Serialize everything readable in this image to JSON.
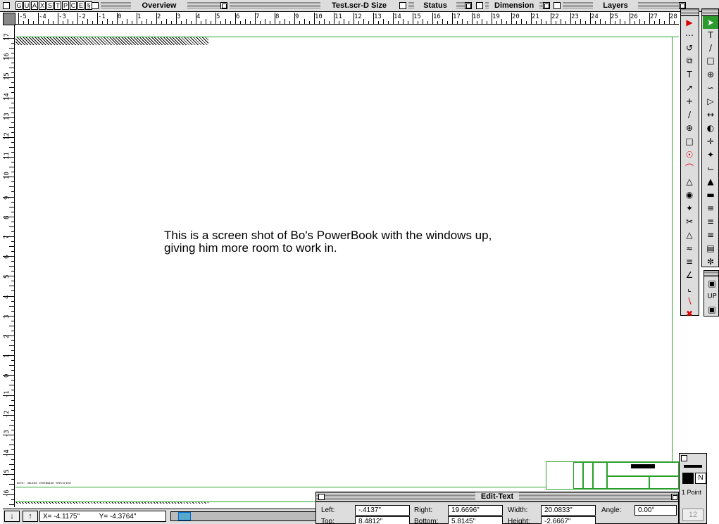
{
  "window": {
    "title": "Test.scr-D Size",
    "tool_letters": [
      "G",
      "U",
      "A",
      "X",
      "S",
      "T",
      "P",
      "C",
      "E",
      "§"
    ]
  },
  "palettes": {
    "overview": "Overview",
    "status": "Status",
    "dimension": "Dimension",
    "layers": "Layers",
    "edit_text": "Edit-Text"
  },
  "rulers": {
    "top_labels": [
      "-5",
      "-4",
      "-3",
      "-2",
      "-1",
      "0",
      "1",
      "2",
      "3",
      "4",
      "5",
      "6",
      "7",
      "8",
      "9",
      "10",
      "11",
      "12",
      "13",
      "14",
      "15",
      "16",
      "17",
      "18",
      "19",
      "20",
      "21",
      "22",
      "23",
      "24",
      "25",
      "26",
      "27",
      "28"
    ],
    "left_labels": [
      "17",
      "16",
      "15",
      "14",
      "13",
      "12",
      "11",
      "10",
      "9",
      "8",
      "7",
      "6",
      "5",
      "4",
      "3",
      "2",
      "1",
      "0",
      "-1",
      "-2",
      "-3",
      "-4",
      "-5",
      "-6"
    ]
  },
  "canvas": {
    "note_line1": "This is a screen shot of Bo's PowerBook with the windows up,",
    "note_line2": "giving him more room to work in.",
    "footnote": "NOTE: UNLESS OTHERWISE SPECIFIED"
  },
  "status": {
    "x_label": "X=",
    "x_value": "-4.1175\"",
    "y_label": "Y=",
    "y_value": "-4.3764\""
  },
  "edit_text": {
    "left_label": "Left:",
    "left_value": "-.4137\"",
    "right_label": "Right:",
    "right_value": "19.6696\"",
    "width_label": "Width:",
    "width_value": "20.0833\"",
    "angle_label": "Angle:",
    "angle_value": "0.00°",
    "top_label": "Top:",
    "top_value": "8.4812\"",
    "bottom_label": "Bottom:",
    "bottom_value": "5.8145\"",
    "height_label": "Height:",
    "height_value": "-2.6667\""
  },
  "tool_palette": {
    "letter_tool": "T",
    "up_label": "UP"
  },
  "pen": {
    "pattern_letter": "N",
    "weight_label": "1 Point",
    "size_value": "12"
  },
  "colors": {
    "selected_tool": "#2d9a2d",
    "guide_line": "#2aa02a",
    "delete_tool": "#d00000"
  }
}
